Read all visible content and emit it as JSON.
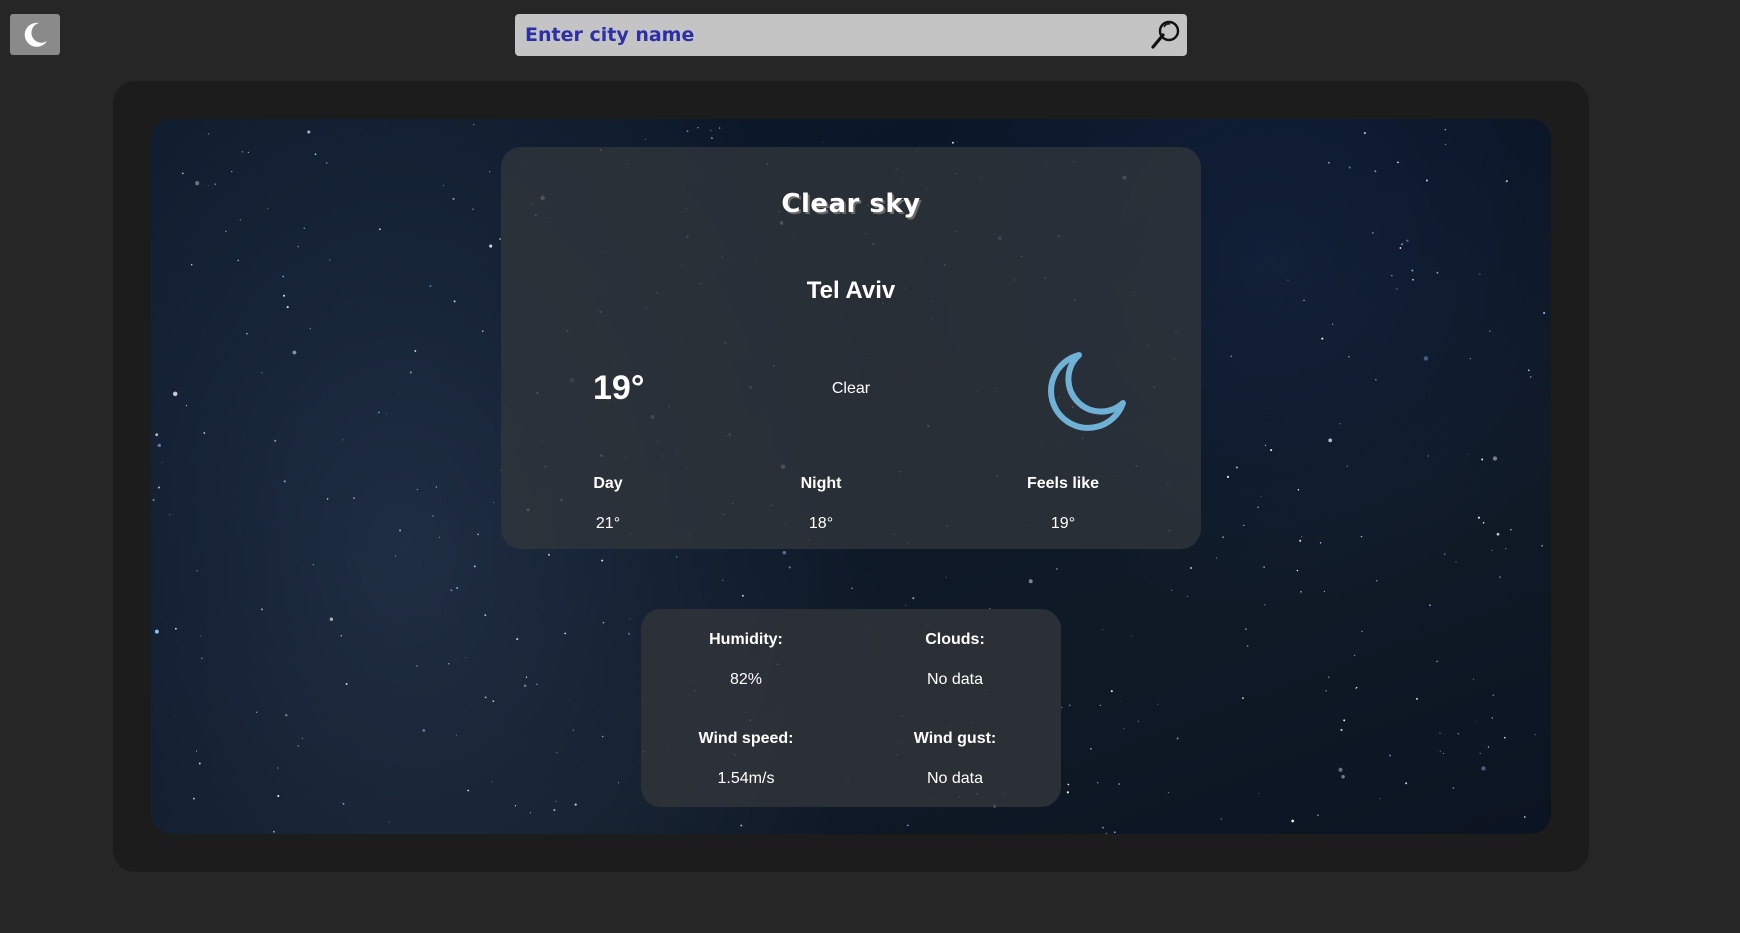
{
  "theme_toggle": {
    "icon": "moon-icon"
  },
  "search": {
    "placeholder": "Enter city name",
    "value": "",
    "icon": "search-icon"
  },
  "weather": {
    "condition_title": "Clear sky",
    "city": "Tel Aviv",
    "temperature": "19°",
    "condition": "Clear",
    "condition_icon": "moon-icon",
    "day_label": "Day",
    "day_value": "21°",
    "night_label": "Night",
    "night_value": "18°",
    "feels_label": "Feels like",
    "feels_value": "19°"
  },
  "details": {
    "humidity_label": "Humidity:",
    "humidity_value": "82%",
    "clouds_label": "Clouds:",
    "clouds_value": "No data",
    "wind_speed_label": "Wind speed:",
    "wind_speed_value": "1.54m/s",
    "wind_gust_label": "Wind gust:",
    "wind_gust_value": "No data"
  },
  "colors": {
    "page_bg": "#262626",
    "frame_bg": "#1c1c1c",
    "card_bg": "#30343a",
    "search_bg": "#c4c4c4",
    "search_text": "#2c2fa8",
    "moon_accent": "#6fb2d6"
  }
}
